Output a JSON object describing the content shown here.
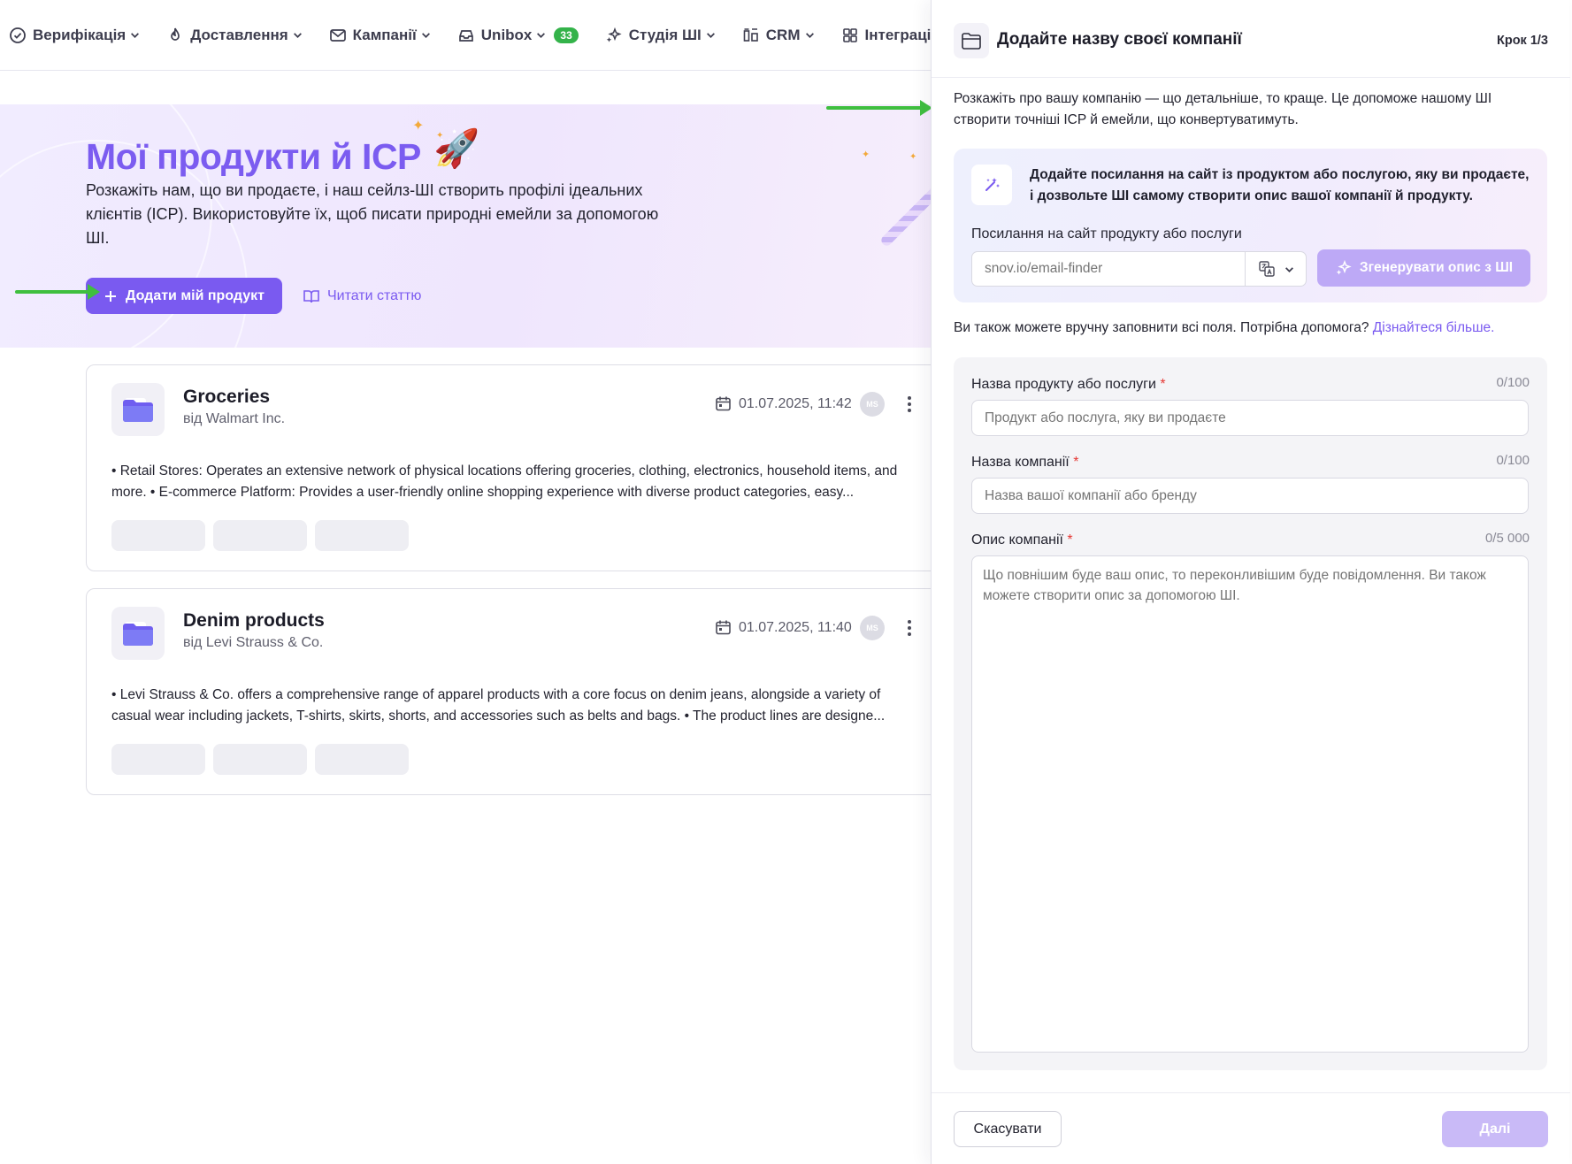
{
  "nav": {
    "items": [
      {
        "label": "Верифікація",
        "icon": "check-circle-icon"
      },
      {
        "label": "Доставлення",
        "icon": "flame-icon"
      },
      {
        "label": "Кампанії",
        "icon": "mail-icon"
      },
      {
        "label": "Unibox",
        "icon": "inbox-icon",
        "badge": "33"
      },
      {
        "label": "Студія ШІ",
        "icon": "sparkles-icon"
      },
      {
        "label": "CRM",
        "icon": "crm-icon"
      },
      {
        "label": "Інтеграції",
        "icon": "grid-icon"
      }
    ]
  },
  "hero": {
    "title": "Мої продукти й ICP",
    "description": "Розкажіть нам, що ви продаєте, і наш сейлз-ШІ створить профілі ідеальних клієнтів (ICP). Використовуйте їх, щоб писати природні емейли за допомогою ШІ.",
    "add_button": "Додати мій продукт",
    "read_link": "Читати статтю"
  },
  "products": [
    {
      "title": "Groceries",
      "subtitle": "від Walmart Inc.",
      "date": "01.07.2025, 11:42",
      "avatar": "MS",
      "description": "• Retail Stores: Operates an extensive network of physical locations offering groceries, clothing, electronics, household items, and more. • E-commerce Platform: Provides a user-friendly online shopping experience with diverse product categories, easy..."
    },
    {
      "title": "Denim products",
      "subtitle": "від Levi Strauss & Co.",
      "date": "01.07.2025, 11:40",
      "avatar": "MS",
      "description": "• Levi Strauss & Co. offers a comprehensive range of apparel products with a core focus on denim jeans, alongside a variety of casual wear including jackets, T-shirts, skirts, shorts, and accessories such as belts and bags. • The product lines are designe..."
    }
  ],
  "drawer": {
    "title": "Додайте назву своєї компанії",
    "step": "Крок 1/3",
    "intro": "Розкажіть про вашу компанію — що детальніше, то краще. Це допоможе нашому ШІ створити точніші ICP й емейли, що конвертуватимуть.",
    "ai": {
      "text": "Додайте посилання на сайт із продуктом або послугою, яку ви продаєте, і дозвольте ШІ самому створити опис вашої компанії й продукту.",
      "label": "Посилання на сайт продукту або послуги",
      "placeholder": "snov.io/email-finder",
      "generate_button": "Згенерувати опис з ШІ"
    },
    "manual_text": "Ви також можете вручну заповнити всі поля. Потрібна допомога? ",
    "manual_link": "Дізнайтеся більше.",
    "fields": {
      "product_label": "Назва продукту або послуги",
      "product_count": "0/100",
      "product_placeholder": "Продукт або послуга, яку ви продаєте",
      "company_label": "Назва компанії",
      "company_count": "0/100",
      "company_placeholder": "Назва вашої компанії або бренду",
      "description_label": "Опис компанії",
      "description_count": "0/5 000",
      "description_placeholder": "Що повнішим буде ваш опис, то переконливішим буде повідомлення. Ви також можете створити опис за допомогою ШІ.",
      "required_mark": "*"
    },
    "cancel_button": "Скасувати",
    "next_button": "Далі"
  },
  "colors": {
    "accent": "#7a5af0",
    "annotation_arrow": "#3fbf3f",
    "badge": "#34b34a"
  }
}
